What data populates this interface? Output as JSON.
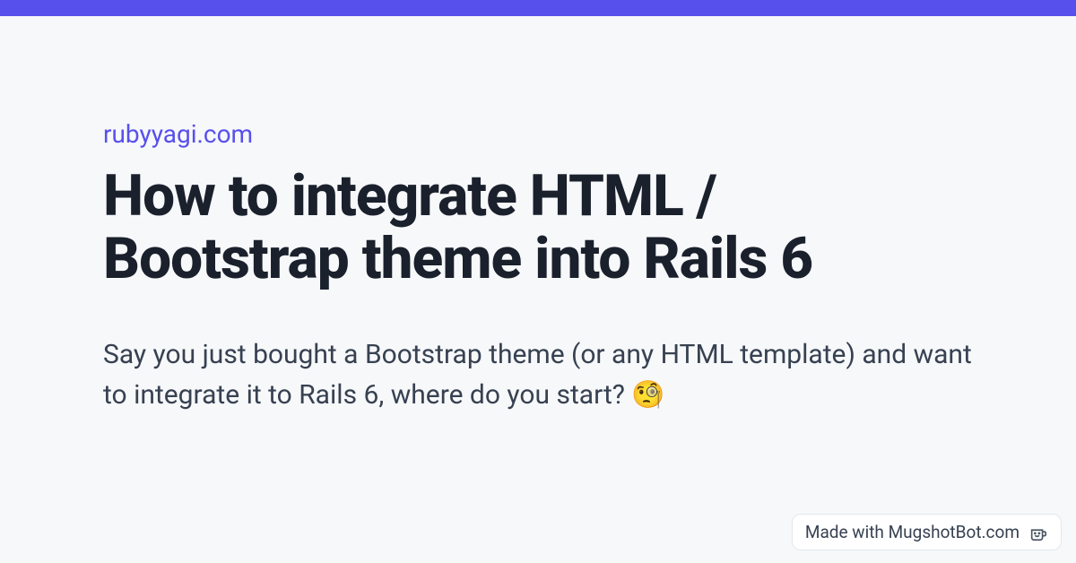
{
  "site": "rubyyagi.com",
  "title": "How to integrate HTML / Bootstrap theme into Rails 6",
  "description": "Say you just bought a Bootstrap theme (or any HTML template) and want to integrate it to Rails 6, where do you start? 🧐",
  "badge": {
    "text": "Made with MugshotBot.com"
  },
  "colors": {
    "accent": "#5850ec",
    "background": "#f7f8fa",
    "heading": "#1a202c",
    "body": "#374151"
  }
}
